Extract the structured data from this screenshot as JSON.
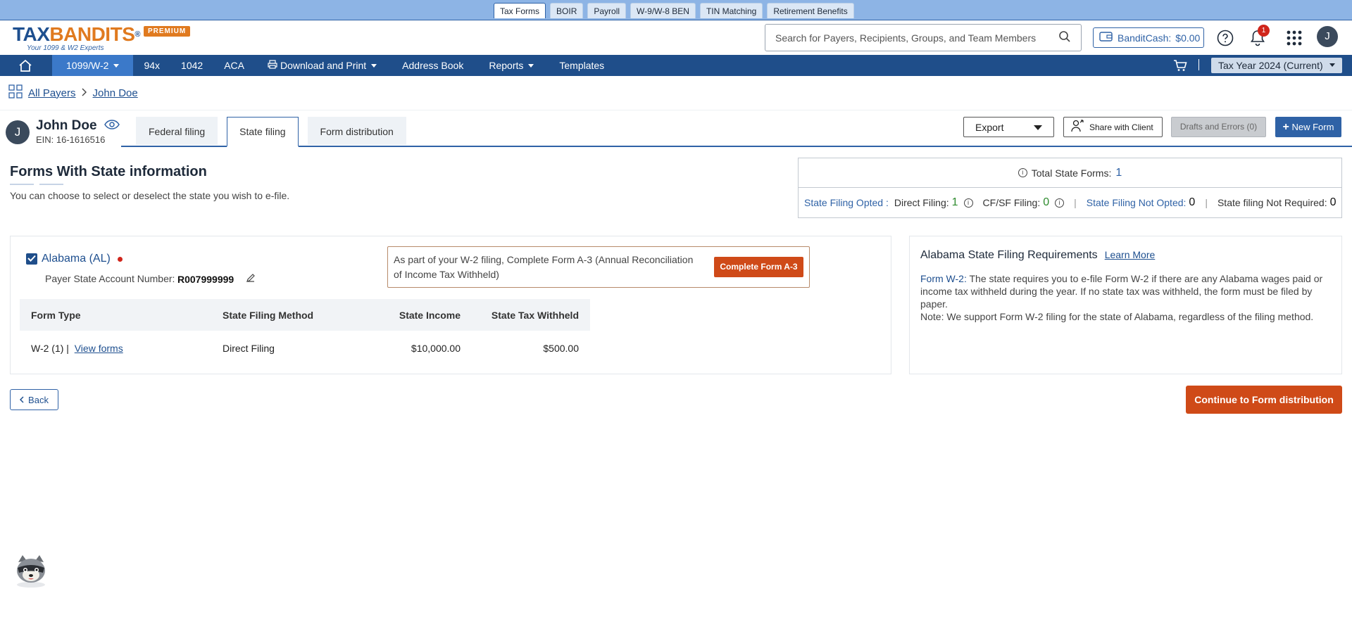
{
  "product_tabs": [
    "Tax Forms",
    "BOIR",
    "Payroll",
    "W-9/W-8 BEN",
    "TIN Matching",
    "Retirement Benefits"
  ],
  "logo": {
    "main_a": "TAX",
    "main_b": "BANDITS",
    "reg": "®",
    "tagline": "Your 1099 & W2 Experts",
    "badge": "PREMIUM"
  },
  "search": {
    "placeholder": "Search for Payers, Recipients, Groups, and Team Members"
  },
  "banditcash": {
    "label": "BanditCash:",
    "value": "$0.00"
  },
  "notifications": {
    "count": "1"
  },
  "user": {
    "initial": "J"
  },
  "nav": {
    "items": [
      "1099/W-2",
      "94x",
      "1042",
      "ACA",
      "Download and Print",
      "Address Book",
      "Reports",
      "Templates"
    ],
    "tax_year": "Tax Year 2024 (Current)"
  },
  "breadcrumb": {
    "root": "All Payers",
    "current": "John Doe"
  },
  "payer": {
    "initial": "J",
    "name": "John Doe",
    "ein": "EIN: 16-1616516"
  },
  "subtabs": [
    "Federal filing",
    "State filing",
    "Form distribution"
  ],
  "actions": {
    "export": "Export",
    "share": "Share with Client",
    "drafts": "Drafts and Errors (0)",
    "new_form": "New  Form"
  },
  "section": {
    "title": "Forms With State information",
    "subtitle": "You can choose to select or deselect the state you wish to e-file."
  },
  "summary": {
    "total_label": "Total State Forms:",
    "total_value": "1",
    "opted_label": "State Filing Opted :",
    "direct_label": "Direct Filing:",
    "direct_value": "1",
    "cfsf_label": "CF/SF Filing:",
    "cfsf_value": "0",
    "not_opted_label": "State Filing Not Opted:",
    "not_opted_value": "0",
    "not_required_label": "State filing Not Required:",
    "not_required_value": "0"
  },
  "state": {
    "name": "Alabama (AL)",
    "acct_label": "Payer State Account Number:",
    "acct_value": "R007999999",
    "a3_notice": "As part of your W-2 filing, Complete Form A-3 (Annual Reconciliation of Income Tax Withheld)",
    "a3_button": "Complete Form A-3",
    "table": {
      "headers": [
        "Form Type",
        "State Filing Method",
        "State Income",
        "State Tax Withheld"
      ],
      "row": {
        "form_type": "W-2  (1)  |",
        "view": "View forms",
        "method": "Direct Filing",
        "income": "$10,000.00",
        "withheld": "$500.00"
      }
    }
  },
  "requirements": {
    "title": "Alabama State Filing Requirements",
    "learn_more": "Learn More",
    "form_label": "Form W-2:",
    "form_text": " The state requires you to e-file Form W-2 if there are any Alabama wages paid or income tax withheld during the year. If no state tax was withheld, the form must be filed by paper.",
    "note": "Note: We support Form W-2 filing for the state of Alabama, regardless of the filing method."
  },
  "footer": {
    "back": "Back",
    "continue": "Continue to Form distribution"
  }
}
